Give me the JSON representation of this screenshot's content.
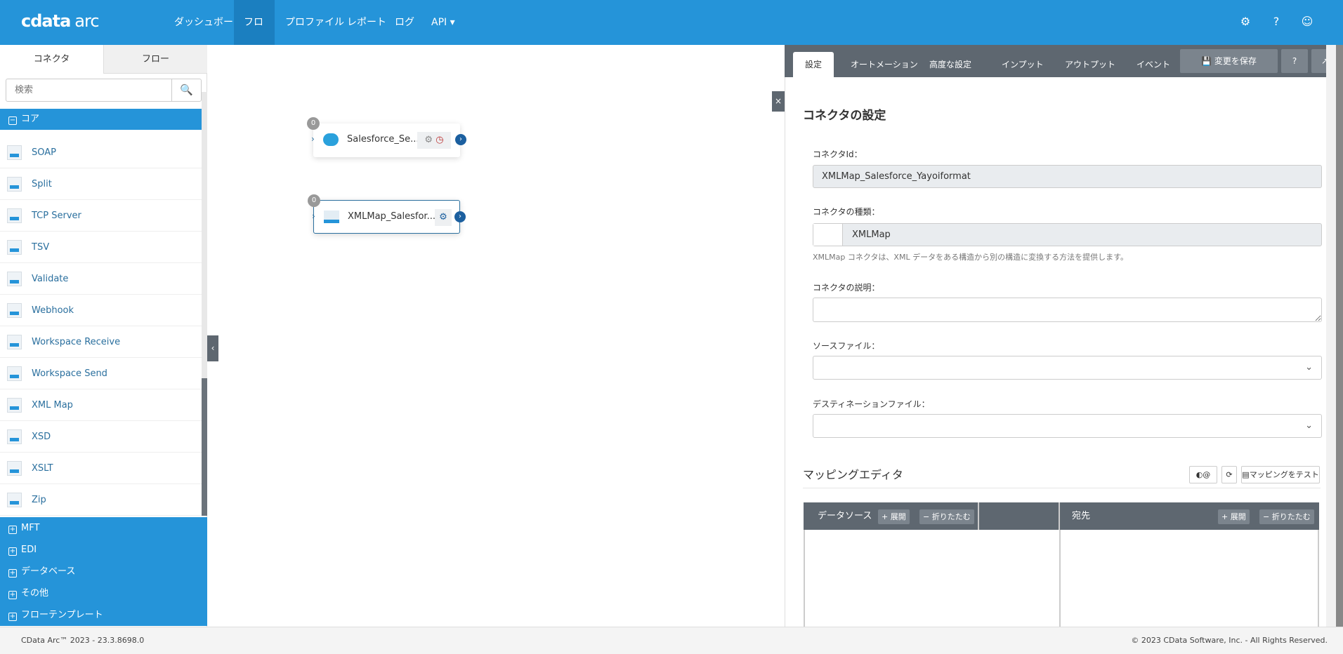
{
  "header": {
    "logo": "cdata",
    "logo_suffix": "arc",
    "nav": [
      {
        "label": "ダッシュボード"
      },
      {
        "label": "フロー",
        "active": true
      },
      {
        "label": "プロファイル"
      },
      {
        "label": "レポート"
      },
      {
        "label": "ログ"
      },
      {
        "label": "API ▾"
      }
    ],
    "icons": [
      "gear-icon",
      "help-icon",
      "user-icon"
    ]
  },
  "sidebar": {
    "tabs": [
      "コネクタ",
      "フロー"
    ],
    "search_placeholder": "検索",
    "core_label": "コア",
    "items": [
      "SOAP",
      "Split",
      "TCP Server",
      "TSV",
      "Validate",
      "Webhook",
      "Workspace Receive",
      "Workspace Send",
      "XML Map",
      "XSD",
      "XSLT",
      "Zip"
    ],
    "categories": [
      "MFT",
      "EDI",
      "データベース",
      "その他",
      "フローテンプレート"
    ]
  },
  "canvas": {
    "nodes": [
      {
        "label": "Salesforce_Se...",
        "count": "0"
      },
      {
        "label": "XMLMap_Salesfor...",
        "count": "0"
      }
    ]
  },
  "panel": {
    "tabs": [
      "設定",
      "オートメーション",
      "高度な設定",
      "インプット",
      "アウトプット",
      "イベント"
    ],
    "save_label": "変更を保存",
    "title": "コネクタの設定",
    "id_label": "コネクタId：",
    "id_value": "XMLMap_Salesforce_Yayoiformat",
    "type_label": "コネクタの種類：",
    "type_value": "XMLMap",
    "type_help": "XMLMap コネクタは、XML データをある構造から別の構造に変換する方法を提供します。",
    "desc_label": "コネクタの説明：",
    "desc_value": "",
    "source_label": "ソースファイル：",
    "dest_label": "デスティネーションファイル：",
    "mapping": {
      "title": "マッピングエディタ",
      "at_label": "@",
      "test_label": "マッピングをテスト",
      "source_header": "データソース",
      "dest_header": "宛先",
      "expand": "+ 展開",
      "collapse": "− 折りたたむ"
    }
  },
  "footer": {
    "version": "CData Arc™ 2023 - 23.3.8698.0",
    "copyright": "© 2023 CData Software, Inc. - All Rights Reserved."
  },
  "colors": {
    "brand": "#2594d9",
    "dark": "#5e6770"
  }
}
